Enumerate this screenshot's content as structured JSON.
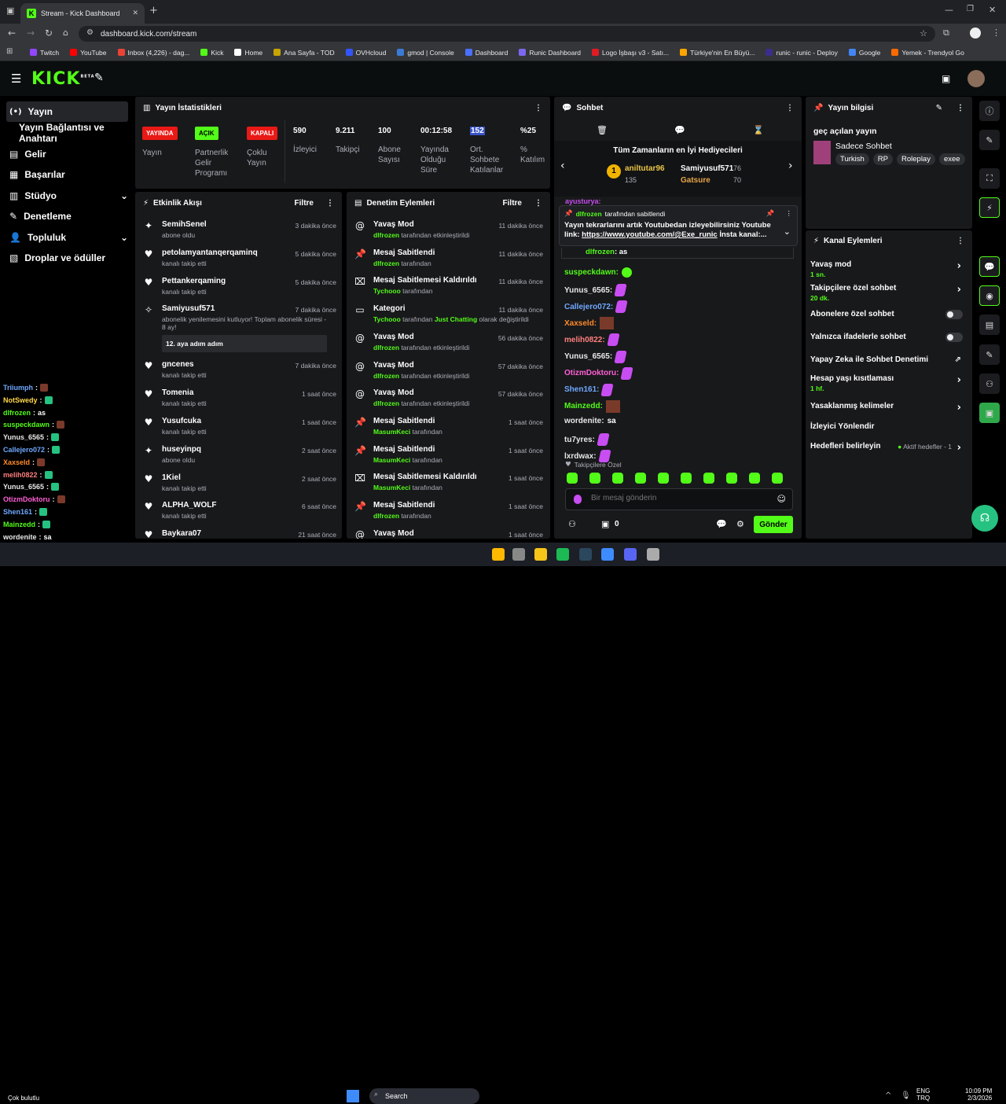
{
  "browser": {
    "tab_title": "Stream - Kick Dashboard",
    "url": "dashboard.kick.com/stream",
    "bookmarks": [
      "Twitch",
      "YouTube",
      "Inbox (4,226) - dag...",
      "Kick",
      "Home",
      "Ana Sayfa - TOD",
      "OVHcloud",
      "gmod | Console",
      "Dashboard",
      "Runic Dashboard",
      "Logo İşbaşı v3 - Satı...",
      "Türkiye'nin En Büyü...",
      "runic - runic - Deploy",
      "Google",
      "Yemek - Trendyol Go"
    ]
  },
  "header": {
    "logo": "KICK",
    "beta": "BETA"
  },
  "sidebar": {
    "items": [
      {
        "label": "Yayın",
        "icon": "broadcast-icon"
      },
      {
        "label": "Yayın Bağlantısı ve Anahtarı"
      },
      {
        "label": "Gelir",
        "icon": "revenue-icon"
      },
      {
        "label": "Başarılar",
        "icon": "achievements-icon"
      },
      {
        "label": "Stüdyo",
        "icon": "studio-icon"
      },
      {
        "label": "Denetleme",
        "icon": "moderation-icon"
      },
      {
        "label": "Topluluk",
        "icon": "community-icon"
      },
      {
        "label": "Droplar ve ödüller",
        "icon": "drops-icon"
      }
    ]
  },
  "stats": {
    "title": "Yayın İstatistikleri",
    "badges": [
      {
        "badge": "YAYINDA",
        "label": "Yayın",
        "color": "#e91916"
      },
      {
        "badge": "AÇIK",
        "label": "Partnerlik Gelir Programı",
        "color": "#53fc18"
      },
      {
        "badge": "KAPALI",
        "label": "Çoklu Yayın",
        "color": "#e91916"
      }
    ],
    "metrics": [
      {
        "value": "590",
        "label": "İzleyici"
      },
      {
        "value": "9.211",
        "label": "Takipçi"
      },
      {
        "value": "100",
        "label": "Abone Sayısı"
      },
      {
        "value": "00:12:58",
        "label": "Yayında Olduğu Süre"
      },
      {
        "value": "152",
        "label": "Ort. Sohbete Katılanlar"
      },
      {
        "value": "%25",
        "label": "% Katılım"
      }
    ]
  },
  "activity": {
    "title": "Etkinlik Akışı",
    "filter": "Filtre",
    "events": [
      {
        "name": "SemihSenel",
        "desc": "abone oldu",
        "time": "3 dakika önce",
        "icon": "sparkle-icon"
      },
      {
        "name": "petolamyantanqerqaminq",
        "desc": "kanalı takip etti",
        "time": "5 dakika önce",
        "icon": "heart-icon"
      },
      {
        "name": "Pettankerqaming",
        "desc": "kanalı takip etti",
        "time": "5 dakika önce",
        "icon": "heart-icon"
      },
      {
        "name": "Samiyusuf571",
        "desc": "abonelik yenilemesini kutluyor! Toplam abonelik süresi - 8 ay!",
        "time": "7 dakika önce",
        "icon": "party-icon",
        "extra": "12. aya adım adım"
      },
      {
        "name": "gncenes",
        "desc": "kanalı takip etti",
        "time": "7 dakika önce",
        "icon": "heart-icon"
      },
      {
        "name": "Tomenia",
        "desc": "kanalı takip etti",
        "time": "1 saat önce",
        "icon": "heart-icon"
      },
      {
        "name": "Yusufcuka",
        "desc": "kanalı takip etti",
        "time": "1 saat önce",
        "icon": "heart-icon"
      },
      {
        "name": "huseyinpq",
        "desc": "abone oldu",
        "time": "2 saat önce",
        "icon": "sparkle-icon"
      },
      {
        "name": "1Kiel",
        "desc": "kanalı takip etti",
        "time": "2 saat önce",
        "icon": "heart-icon"
      },
      {
        "name": "ALPHA_WOLF",
        "desc": "kanalı takip etti",
        "time": "6 saat önce",
        "icon": "heart-icon"
      },
      {
        "name": "Baykara07",
        "desc": "",
        "time": "21 saat önce",
        "icon": "heart-icon"
      }
    ]
  },
  "modlog": {
    "title": "Denetim Eylemleri",
    "filter": "Filtre",
    "actions": [
      {
        "title": "Yavaş Mod",
        "user": "dlfrozen",
        "rest": "tarafından etkinleştirildi",
        "time": "11 dakika önce",
        "icon": "snail-icon"
      },
      {
        "title": "Mesaj Sabitlendi",
        "user": "dlfrozen",
        "rest": "tarafından",
        "time": "11 dakika önce",
        "icon": "pin-icon"
      },
      {
        "title": "Mesaj Sabitlemesi Kaldırıldı",
        "user": "Tychooo",
        "rest": "tarafından",
        "time": "11 dakika önce",
        "icon": "unpin-icon"
      },
      {
        "title": "Kategori",
        "user": "Tychooo",
        "rest": "tarafından",
        "cat": "Just Chatting",
        "rest2": "olarak değiştirildi",
        "time": "11 dakika önce",
        "icon": "category-icon"
      },
      {
        "title": "Yavaş Mod",
        "user": "dlfrozen",
        "rest": "tarafından etkinleştirildi",
        "time": "56 dakika önce",
        "icon": "snail-icon"
      },
      {
        "title": "Yavaş Mod",
        "user": "dlfrozen",
        "rest": "tarafından etkinleştirildi",
        "time": "57 dakika önce",
        "icon": "snail-icon"
      },
      {
        "title": "Yavaş Mod",
        "user": "dlfrozen",
        "rest": "tarafından etkinleştirildi",
        "time": "57 dakika önce",
        "icon": "snail-icon"
      },
      {
        "title": "Mesaj Sabitlendi",
        "user": "MasumKeci",
        "rest": "tarafından",
        "time": "1 saat önce",
        "icon": "pin-icon"
      },
      {
        "title": "Mesaj Sabitlendi",
        "user": "MasumKeci",
        "rest": "tarafından",
        "time": "1 saat önce",
        "icon": "pin-icon"
      },
      {
        "title": "Mesaj Sabitlemesi Kaldırıldı",
        "user": "MasumKeci",
        "rest": "tarafından",
        "time": "1 saat önce",
        "icon": "unpin-icon"
      },
      {
        "title": "Mesaj Sabitlendi",
        "user": "dlfrozen",
        "rest": "tarafından",
        "time": "1 saat önce",
        "icon": "pin-icon"
      },
      {
        "title": "Yavaş Mod",
        "user": "",
        "rest": "",
        "time": "1 saat önce",
        "icon": "snail-icon"
      }
    ]
  },
  "chat": {
    "title": "Sohbet",
    "gifters_title": "Tüm Zamanların en İyi Hediyecileri",
    "gifters": [
      {
        "rank": "1",
        "name": "aniltutar96",
        "count": "135"
      },
      {
        "name": "Samiyusuf571",
        "count": "76"
      },
      {
        "name": "Gatsure",
        "count": "70"
      }
    ],
    "pinned_by": "dlfrozen",
    "pinned_by_suffix": "tarafından sabitlendi",
    "pinned_text": "Yayın tekrarlarını artık Youtubedan izleyebilirsiniz Youtube link:",
    "pinned_link": "https://www.youtube.com/@Exe_runic",
    "pinned_tail": "İnsta kanal:...",
    "top_partial": "ayusturya:",
    "reply_user": "dlfrozen",
    "reply_text": "as",
    "messages": [
      {
        "user": "suspeckdawn:",
        "color": "#53fc18",
        "emote": "green"
      },
      {
        "user": "Yunus_6565:",
        "color": "#e8e8e8",
        "emote": "purple"
      },
      {
        "user": "Callejero072:",
        "color": "#6fa8ff",
        "emote": "purple"
      },
      {
        "user": "Xaxseld:",
        "color": "#ff8a2b",
        "emote": "brown"
      },
      {
        "user": "melih0822:",
        "color": "#ff7f7f",
        "emote": "purple"
      },
      {
        "user": "Yunus_6565:",
        "color": "#e8e8e8",
        "emote": "purple"
      },
      {
        "user": "OtizmDoktoru:",
        "color": "#ff5fd6",
        "emote": "purple"
      },
      {
        "user": "Shen161:",
        "color": "#6fa8ff",
        "emote": "purple"
      },
      {
        "user": "Mainzedd:",
        "color": "#53fc18",
        "emote": "brown"
      },
      {
        "user": "wordenite:",
        "color": "#e8e8e8",
        "text": "sa"
      },
      {
        "user": "tu7yres:",
        "color": "#e8e8e8",
        "emote": "purple"
      },
      {
        "user": "lxrdwax:",
        "color": "#e8e8e8",
        "emote": "purple"
      }
    ],
    "followers_only": "Takipçilere Özel",
    "input_placeholder": "Bir mesaj gönderin",
    "points": "0",
    "send": "Gönder"
  },
  "streaminfo": {
    "title": "Yayın bilgisi",
    "stream_title": "geç açılan yayın",
    "category": "Sadece Sohbet",
    "tags": [
      "Turkish",
      "RP",
      "Roleplay",
      "exee"
    ]
  },
  "channel_actions": {
    "title": "Kanal Eylemleri",
    "items": [
      {
        "label": "Yavaş mod",
        "sub": "1 sn.",
        "control": "chevron"
      },
      {
        "label": "Takipçilere özel sohbet",
        "sub": "20 dk.",
        "control": "chevron"
      },
      {
        "label": "Abonelere özel sohbet",
        "control": "toggle"
      },
      {
        "label": "Yalnızca ifadelerle sohbet",
        "control": "toggle"
      },
      {
        "label": "Yapay Zeka ile Sohbet Denetimi",
        "control": "external"
      },
      {
        "label": "Hesap yaşı kısıtlaması",
        "sub": "1 hf.",
        "control": "chevron"
      },
      {
        "label": "Yasaklanmış kelimeler",
        "control": "chevron"
      },
      {
        "label": "İzleyici Yönlendir",
        "control": "none"
      },
      {
        "label": "Hedefleri belirleyin",
        "control": "chevron",
        "status": "Aktif hedefler - 1"
      }
    ]
  },
  "overlay_chat": [
    {
      "user": "Triiumph",
      "color": "#6fa8ff"
    },
    {
      "user": "NotSwedy",
      "color": "#ffd84a"
    },
    {
      "user": "dlfrozen",
      "color": "#53fc18",
      "text": "as"
    },
    {
      "user": "suspeckdawn",
      "color": "#53fc18"
    },
    {
      "user": "Yunus_6565",
      "color": "#e8e8e8"
    },
    {
      "user": "Callejero072",
      "color": "#6fa8ff"
    },
    {
      "user": "Xaxseld",
      "color": "#ff8a2b"
    },
    {
      "user": "melih0822",
      "color": "#ff7f7f"
    },
    {
      "user": "Yunus_6565",
      "color": "#e8e8e8"
    },
    {
      "user": "OtizmDoktoru",
      "color": "#ff5fd6"
    },
    {
      "user": "Shen161",
      "color": "#6fa8ff"
    },
    {
      "user": "Mainzedd",
      "color": "#53fc18"
    },
    {
      "user": "wordenite",
      "color": "#e8e8e8",
      "text": "sa"
    },
    {
      "user": "tu7yres",
      "color": "#e8e8e8"
    },
    {
      "user": "lxrdwax",
      "color": "#e8e8e8"
    }
  ],
  "taskbar": {
    "weather": "Çok bulutlu",
    "search": "Search",
    "lang": "ENG",
    "lang2": "TRQ",
    "time": "10:09 PM",
    "date": "2/3/2026"
  }
}
